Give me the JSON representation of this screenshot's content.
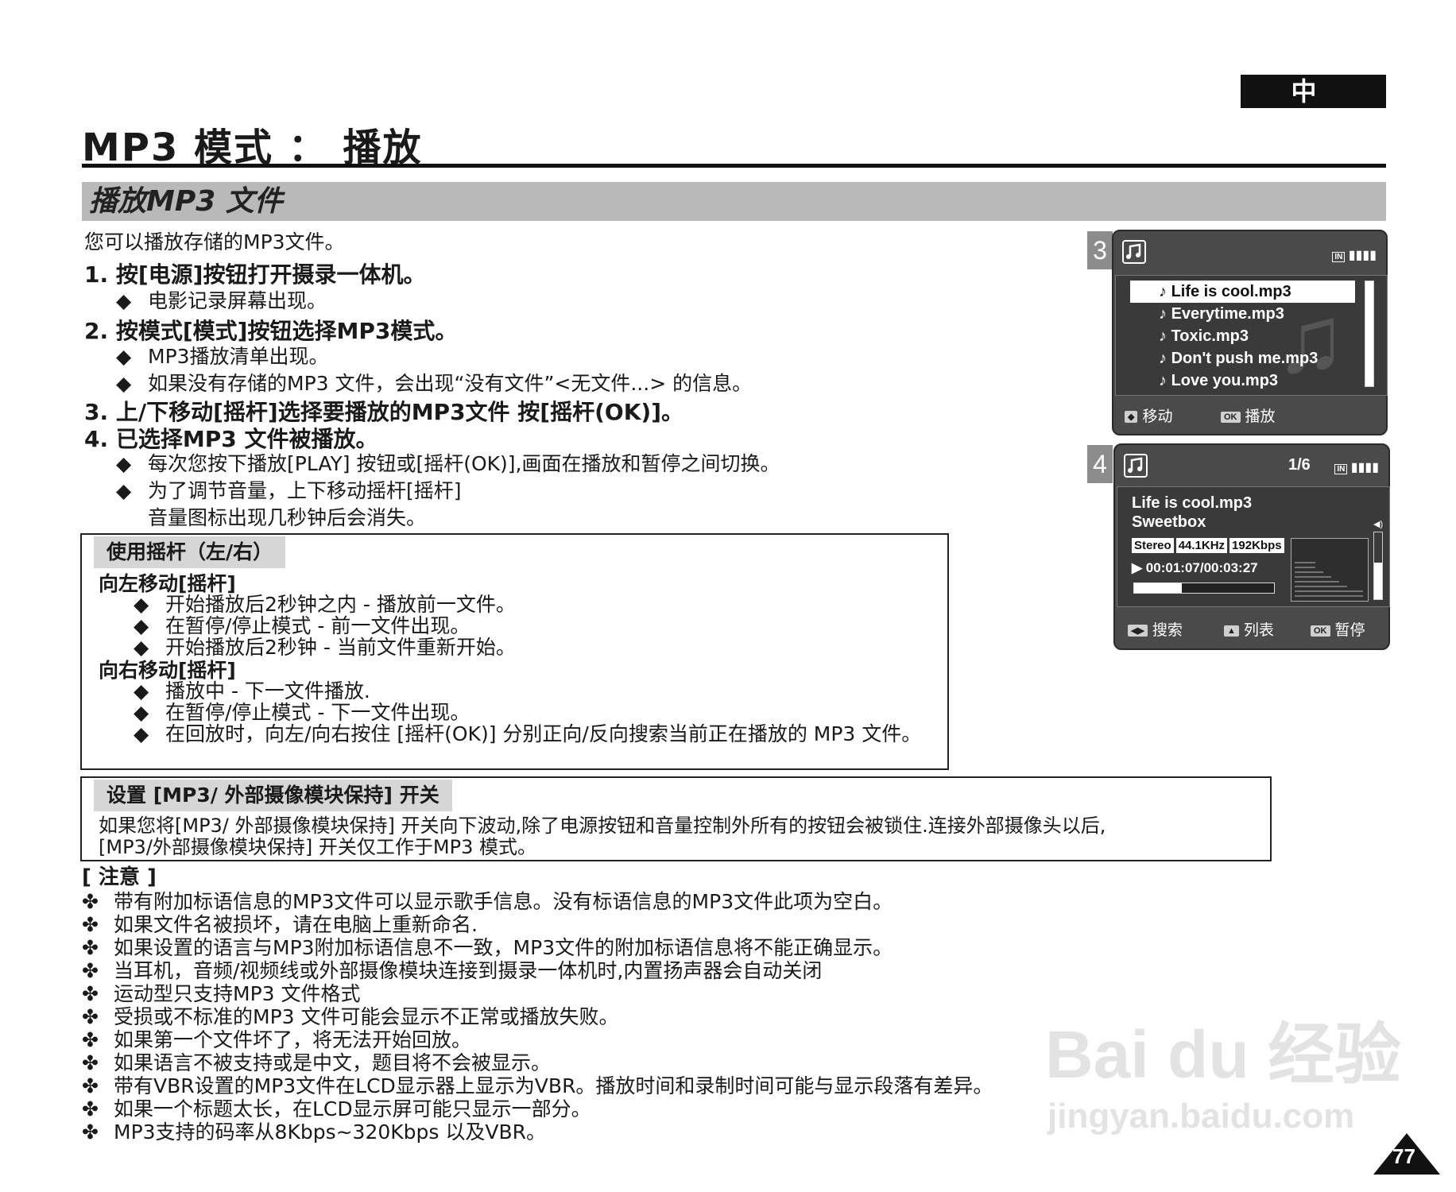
{
  "header": {
    "language_badge": "中 文",
    "page_title": "MP3 模式 ： 播放"
  },
  "section": {
    "title": "播放MP3 文件"
  },
  "intro": "您可以播放存储的MP3文件。",
  "steps": [
    {
      "text": "1. 按[电源]按钮打开摄录一体机。",
      "bullets": [
        "电影记录屏幕出现。"
      ]
    },
    {
      "text": "2. 按模式[模式]按钮选择MP3模式。",
      "bullets": [
        "MP3播放清单出现。",
        "如果没有存储的MP3 文件，会出现“没有文件”<无文件...> 的信息。"
      ]
    },
    {
      "text": "3. 上/下移动[摇杆]选择要播放的MP3文件 按[摇杆(OK)]。",
      "bullets": []
    },
    {
      "text": "4. 已选择MP3 文件被播放。",
      "bullets": [
        "每次您按下播放[PLAY] 按钮或[摇杆(OK)],画面在播放和暂停之间切换。",
        "为了调节音量，上下移动摇杆[摇杆]"
      ],
      "continuation": "音量图标出现几秒钟后会消失。"
    }
  ],
  "joystick_box": {
    "title": "使用摇杆（左/右）",
    "left_title": "向左移动[摇杆]",
    "left_items": [
      "开始播放后2秒钟之内 - 播放前一文件。",
      "在暂停/停止模式 - 前一文件出现。",
      "开始播放后2秒钟 - 当前文件重新开始。"
    ],
    "right_title": "向右移动[摇杆]",
    "right_items": [
      "播放中 - 下一文件播放.",
      "在暂停/停止模式 - 下一文件出现。",
      "在回放时，向左/向右按住 [摇杆(OK)] 分别正向/反向搜索当前正在播放的 MP3 文件。"
    ]
  },
  "hold_box": {
    "title": "设置 [MP3/ 外部摄像模块保持] 开关",
    "line1": "如果您将[MP3/ 外部摄像模块保持] 开关向下波动,除了电源按钮和音量控制外所有的按钮会被锁住.连接外部摄像头以后,",
    "line2": "[MP3/外部摄像模块保持] 开关仅工作于MP3 模式。"
  },
  "notes": {
    "title": "[ 注意 ]",
    "marker": "✤",
    "items": [
      "带有附加标语信息的MP3文件可以显示歌手信息。没有标语信息的MP3文件此项为空白。",
      "如果文件名被损坏，请在电脑上重新命名.",
      "如果设置的语言与MP3附加标语信息不一致，MP3文件的附加标语信息将不能正确显示。",
      "当耳机，音频/视频线或外部摄像模块连接到摄录一体机时,内置扬声器会自动关闭",
      "运动型只支持MP3 文件格式",
      "受损或不标准的MP3 文件可能会显示不正常或播放失败。",
      "如果第一个文件坏了，将无法开始回放。",
      "如果语言不被支持或是中文，题目将不会被显示。",
      "带有VBR设置的MP3文件在LCD显示器上显示为VBR。播放时间和录制时间可能与显示段落有差异。",
      "如果一个标题太长，在LCD显示屏可能只显示一部分。",
      "MP3支持的码率从8Kbps~320Kbps 以及VBR。"
    ]
  },
  "screen3": {
    "number": "3",
    "mode_icon": "music-note-icon",
    "storage_label": "IN",
    "songs": [
      "Life is cool.mp3",
      "Everytime.mp3",
      "Toxic.mp3",
      "Don't push me.mp3",
      "Love you.mp3"
    ],
    "selected_index": 0,
    "footer": {
      "move_key": "◆",
      "move_label": "移动",
      "ok_key": "OK",
      "ok_label": "播放"
    }
  },
  "screen4": {
    "number": "4",
    "mode_icon": "music-note-icon",
    "track_counter": "1/6",
    "storage_label": "IN",
    "title": "Life is cool.mp3",
    "artist": "Sweetbox",
    "tags": [
      "Stereo",
      "44.1KHz",
      "192Kbps"
    ],
    "time": "00:01:07/00:03:27",
    "progress": 0.34,
    "volume_level": 0.55,
    "footer": {
      "search_key": "◀▶",
      "search_label": "搜索",
      "list_key": "▲",
      "list_label": "列表",
      "ok_key": "OK",
      "ok_label": "暂停"
    }
  },
  "watermark": {
    "brand": "Bai du 经验",
    "url": "jingyan.baidu.com"
  },
  "page_number": "77"
}
